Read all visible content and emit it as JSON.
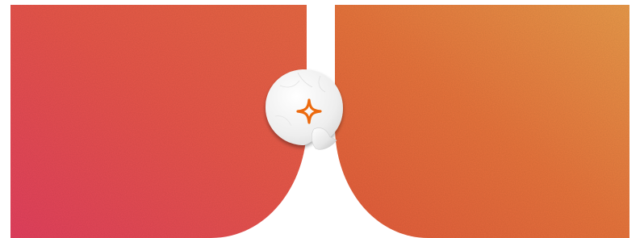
{
  "colors": {
    "panel_left_start": "#e4405e",
    "panel_left_mid": "#e8564a",
    "panel_left_end": "#e86842",
    "panel_right_start": "#e45a3c",
    "panel_right_mid": "#e8743c",
    "panel_right_end": "#ea9a4a",
    "sticker_face": "#f2f2f2",
    "sticker_shadow": "#c9c9c9",
    "star_outline": "#ec6a0e",
    "background": "#ffffff"
  },
  "icons": {
    "sticker_symbol": "four-point-star-icon"
  }
}
